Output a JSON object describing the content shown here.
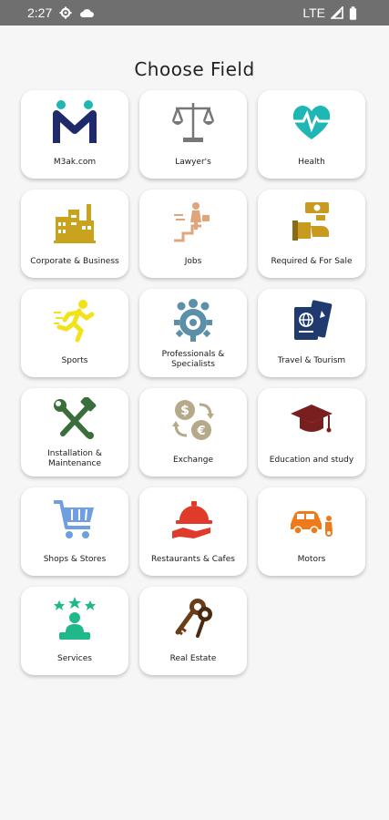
{
  "status_bar": {
    "time": "2:27",
    "network": "LTE"
  },
  "page": {
    "title": "Choose Field"
  },
  "fields": [
    {
      "label": "M3ak.com",
      "icon": "m3ak-logo-icon",
      "color": "#1f2a6b"
    },
    {
      "label": "Lawyer's",
      "icon": "scales-icon",
      "color": "#777777"
    },
    {
      "label": "Health",
      "icon": "heart-pulse-icon",
      "color": "#1fb6b6"
    },
    {
      "label": "Corporate & Business",
      "icon": "factory-icon",
      "color": "#c9a21e"
    },
    {
      "label": "Jobs",
      "icon": "businessman-stairs-icon",
      "color": "#e0a57a"
    },
    {
      "label": "Required & For Sale",
      "icon": "hand-money-icon",
      "color": "#c99a20"
    },
    {
      "label": "Sports",
      "icon": "runner-icon",
      "color": "#f2e21a"
    },
    {
      "label": "Professionals & Specialists",
      "icon": "team-gear-icon",
      "color": "#5c8fa8"
    },
    {
      "label": "Travel & Tourism",
      "icon": "passport-icon",
      "color": "#1e3a6e"
    },
    {
      "label": "Installation & Maintenance",
      "icon": "wrench-hammer-icon",
      "color": "#3a6e3a"
    },
    {
      "label": "Exchange",
      "icon": "currency-exchange-icon",
      "color": "#b5a98a"
    },
    {
      "label": "Education and study",
      "icon": "graduation-cap-icon",
      "color": "#7a1f1f"
    },
    {
      "label": "Shops & Stores",
      "icon": "shopping-cart-icon",
      "color": "#6f9fe0"
    },
    {
      "label": "Restaurants & Cafes",
      "icon": "cloche-hand-icon",
      "color": "#e03a2a"
    },
    {
      "label": "Motors",
      "icon": "car-motorbike-icon",
      "color": "#f07a1a"
    },
    {
      "label": "Services",
      "icon": "service-stars-icon",
      "color": "#1fb88a"
    },
    {
      "label": "Real Estate",
      "icon": "keys-icon",
      "color": "#6b3e1a"
    }
  ]
}
